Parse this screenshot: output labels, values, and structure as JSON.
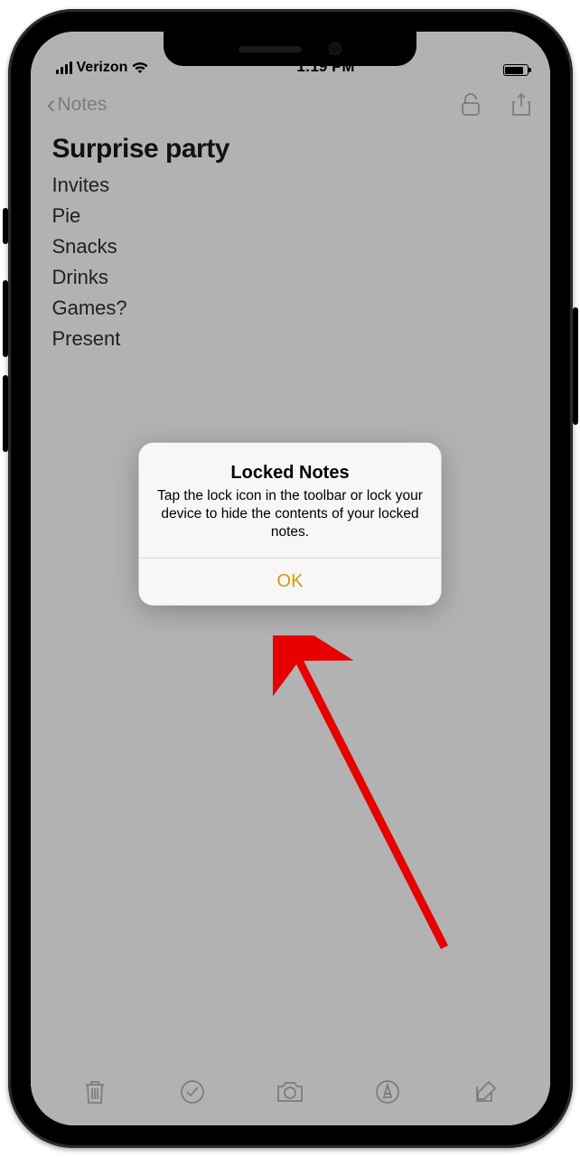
{
  "statusbar": {
    "carrier": "Verizon",
    "time": "1:19 PM"
  },
  "nav": {
    "back_label": "Notes"
  },
  "note": {
    "title": "Surprise party",
    "lines": [
      "Invites",
      "Pie",
      "Snacks",
      "Drinks",
      "Games?",
      "Present"
    ]
  },
  "alert": {
    "title": "Locked Notes",
    "message": "Tap the lock icon in the toolbar or lock your device to hide the contents of your locked notes.",
    "ok_label": "OK"
  }
}
